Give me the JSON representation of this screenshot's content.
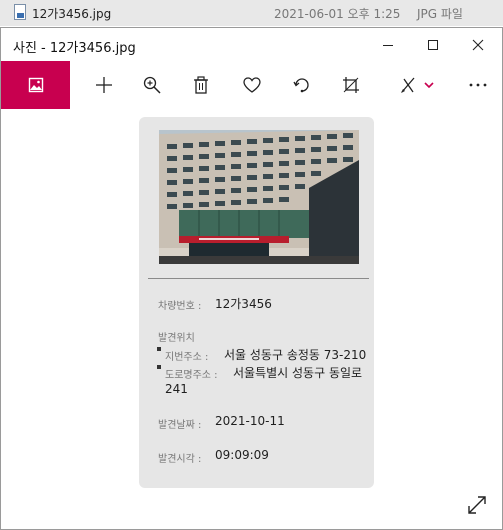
{
  "explorer": {
    "file_name": "12가3456.jpg",
    "modified": "2021-06-01 오후 1:25",
    "type": "JPG 파일"
  },
  "window": {
    "title": "사진 - 12가3456.jpg"
  },
  "toolbar": {
    "items": [
      "home-image-icon",
      "add-icon",
      "zoom-in-icon",
      "delete-icon",
      "favorite-heart-icon",
      "rotate-icon",
      "crop-icon",
      "edit-draw-icon",
      "more-icon"
    ]
  },
  "details": {
    "plate_label": "차량번호 :",
    "plate_value": "12가3456",
    "location_header": "발견위치",
    "lot_label": "지번주소 :",
    "lot_value": "서울 성동구 송정동 73-210",
    "road_label": "도로명주소 :",
    "road_value": "서울특별시 성동구 동일로",
    "road_value_line2": "241",
    "date_label": "발견날짜 :",
    "date_value": "2021-10-11",
    "time_label": "발견시각 :",
    "time_value": "09:09:09"
  },
  "colors": {
    "accent": "#c8004f",
    "card_bg": "#e6e6e6"
  }
}
